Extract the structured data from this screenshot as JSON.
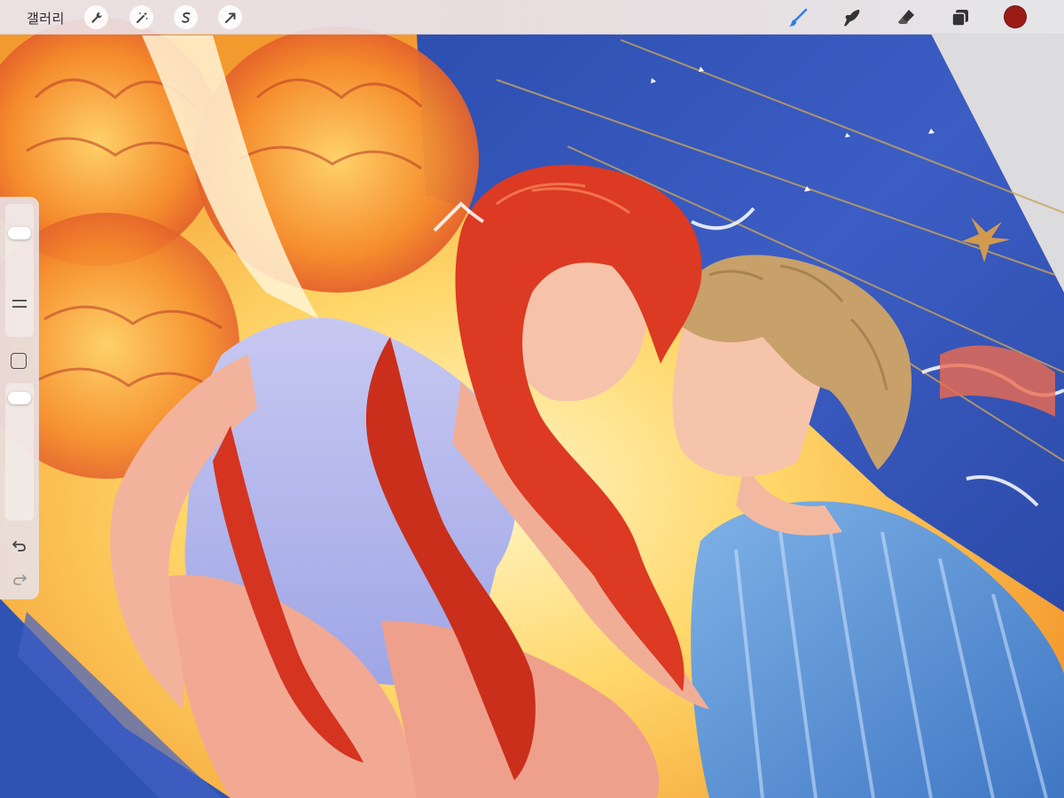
{
  "toolbar": {
    "gallery_label": "갤러리",
    "left_tools": [
      {
        "name": "actions",
        "icon": "wrench-icon"
      },
      {
        "name": "adjustments",
        "icon": "magic-wand-icon"
      },
      {
        "name": "selection",
        "icon": "selection-s-icon"
      },
      {
        "name": "transform",
        "icon": "arrow-cursor-icon"
      }
    ],
    "right_tools": [
      {
        "name": "brush",
        "icon": "brush-icon",
        "active": true
      },
      {
        "name": "smudge",
        "icon": "smudge-finger-icon",
        "active": false
      },
      {
        "name": "eraser",
        "icon": "eraser-icon",
        "active": false
      },
      {
        "name": "layers",
        "icon": "layers-icon",
        "active": false
      }
    ],
    "active_color": "#9b1c17",
    "active_tool_color": "#2f7fe8"
  },
  "sidebar": {
    "brush_size_level": 0.82,
    "brush_opacity_level": 0.95,
    "icons": [
      "modify-square-icon",
      "undo-icon",
      "redo-icon"
    ]
  }
}
